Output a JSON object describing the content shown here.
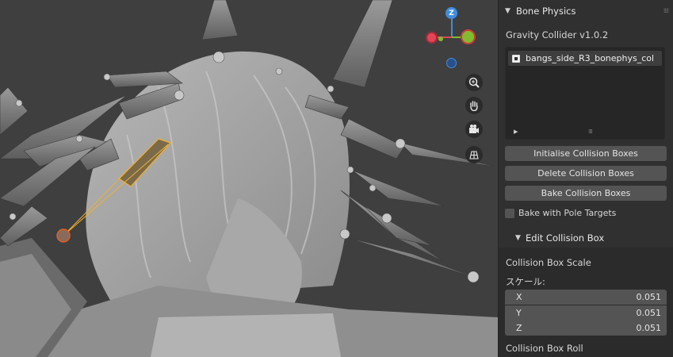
{
  "viewport": {
    "gizmo": {
      "z_label": "Z",
      "x_color": "#e24656",
      "y_color": "#7fbc2e",
      "z_color": "#3f8de0"
    },
    "nav_icons": [
      "zoom-icon",
      "hand-icon",
      "camera-icon",
      "grid-icon"
    ]
  },
  "panel": {
    "header_title": "Bone Physics",
    "collider_version": "Gravity Collider v1.0.2",
    "list_items": [
      {
        "label": "bangs_side_R3_bonephys_col",
        "checked": true
      }
    ],
    "buttons": {
      "initialise": "Initialise Collision Boxes",
      "delete": "Delete Collision Boxes",
      "bake": "Bake Collision Boxes"
    },
    "bake_pole_targets": {
      "label": "Bake with Pole Targets",
      "checked": false
    },
    "edit_box": {
      "header": "Edit Collision Box",
      "scale_label": "Collision Box Scale",
      "scale_sub_label": "スケール:",
      "scale": [
        {
          "axis": "X",
          "value": "0.051"
        },
        {
          "axis": "Y",
          "value": "0.051"
        },
        {
          "axis": "Z",
          "value": "0.051"
        }
      ],
      "roll_label": "Collision Box Roll"
    }
  }
}
